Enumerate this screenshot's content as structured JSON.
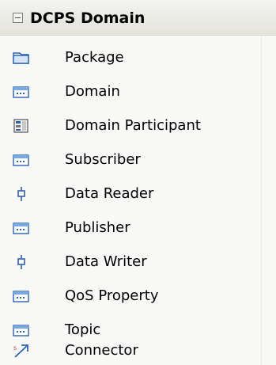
{
  "header": {
    "title": "DCPS Domain"
  },
  "items": [
    {
      "label": "Package",
      "icon": "package-icon"
    },
    {
      "label": "Domain",
      "icon": "class-icon"
    },
    {
      "label": "Domain Participant",
      "icon": "participant-icon"
    },
    {
      "label": "Subscriber",
      "icon": "class-icon"
    },
    {
      "label": "Data Reader",
      "icon": "port-icon"
    },
    {
      "label": "Publisher",
      "icon": "class-icon"
    },
    {
      "label": "Data Writer",
      "icon": "port-icon"
    },
    {
      "label": "QoS Property",
      "icon": "class-icon"
    },
    {
      "label": "Topic",
      "icon": "class-icon"
    },
    {
      "label": "Connector",
      "icon": "connector-icon"
    }
  ],
  "colors": {
    "header_background": "#e9e8e2",
    "panel_background": "#f9f9f8",
    "icon_blue": "#2b62b3"
  }
}
